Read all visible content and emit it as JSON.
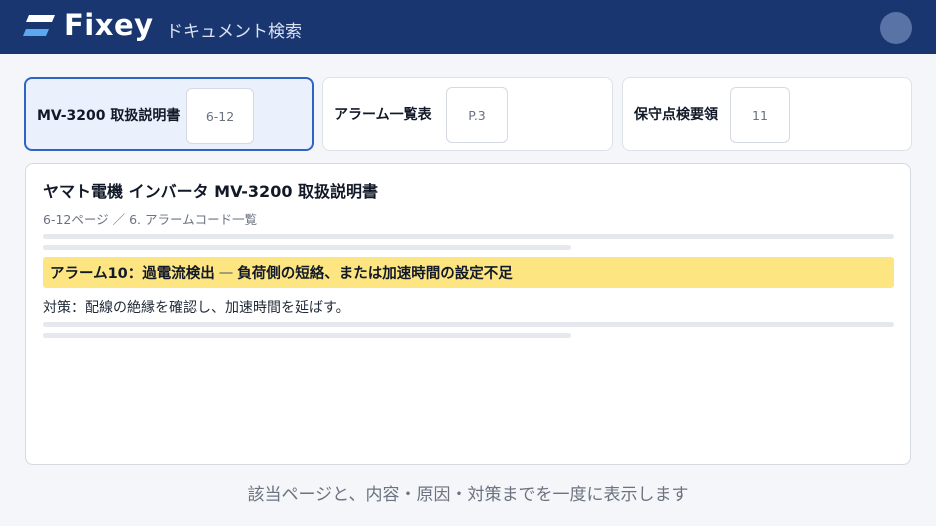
{
  "app": {
    "logo_text": "Fixey",
    "subtitle": "ドキュメント検索"
  },
  "results": [
    {
      "title": "MV-3200 取扱説明書",
      "page": "6-12",
      "active": true
    },
    {
      "title": "アラーム一覧表",
      "page": "P.3",
      "active": false
    },
    {
      "title": "保守点検要領",
      "page": "11",
      "active": false
    }
  ],
  "document": {
    "title": "ヤマト電機 インバータ MV-3200 取扱説明書",
    "path": "6-12ページ ／ 6. アラームコード一覧",
    "highlight_code": "アラーム10：過電流検出",
    "highlight_separator": "—",
    "highlight_cause": "負荷側の短絡、または加速時間の設定不足",
    "remedy": "対策：配線の絶縁を確認し、加速時間を延ばす。"
  },
  "caption": "該当ページと、内容・原因・対策までを一度に表示します",
  "colors": {
    "header_bg": "#1a3670",
    "accent": "#2f64c4",
    "highlight": "#fde682"
  }
}
